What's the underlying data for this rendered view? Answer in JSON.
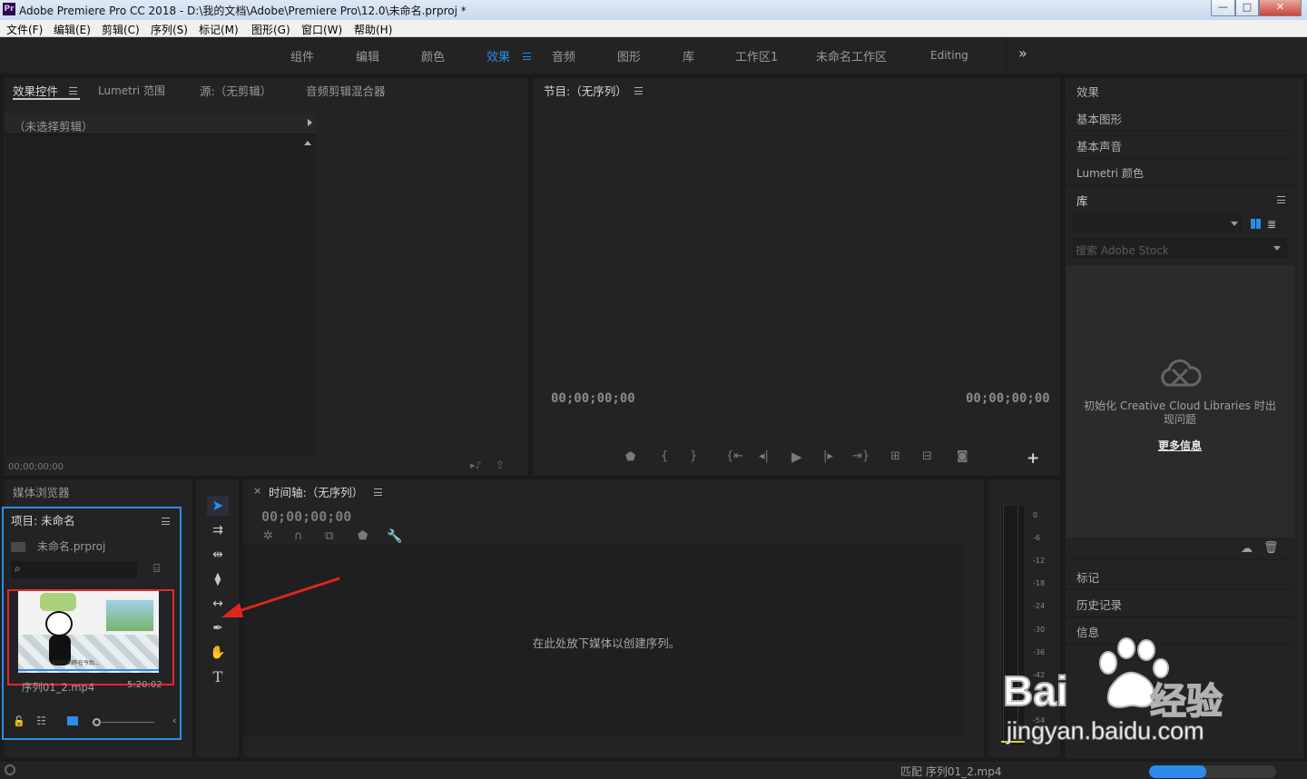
{
  "window": {
    "app_icon": "Pr",
    "title": "Adobe Premiere Pro CC 2018 - D:\\我的文档\\Adobe\\Premiere Pro\\12.0\\未命名.prproj *",
    "controls": {
      "minimize": "—",
      "maximize": "□",
      "close": "✕"
    }
  },
  "menu": [
    "文件(F)",
    "编辑(E)",
    "剪辑(C)",
    "序列(S)",
    "标记(M)",
    "图形(G)",
    "窗口(W)",
    "帮助(H)"
  ],
  "workspaces": {
    "items": [
      "组件",
      "编辑",
      "颜色",
      "效果",
      "音频",
      "图形",
      "库",
      "工作区1",
      "未命名工作区",
      "Editing"
    ],
    "active": "效果",
    "overflow": "»"
  },
  "source_panel": {
    "tabs": [
      "效果控件",
      "Lumetri 范围",
      "源:（无剪辑）",
      "音频剪辑混合器"
    ],
    "active_tab": "效果控件",
    "clip_label": "（未选择剪辑）",
    "timecode": "00;00;00;00"
  },
  "program_panel": {
    "title": "节目:（无序列）",
    "timecode_left": "00;00;00;00",
    "timecode_right": "00;00;00;00",
    "add_button": "+"
  },
  "right_panel": {
    "items": [
      "效果",
      "基本图形",
      "基本声音",
      "Lumetri 颜色"
    ],
    "library_title": "库",
    "stock_placeholder": "搜索 Adobe Stock",
    "cloud_message_1": "初始化 Creative Cloud Libraries 时出",
    "cloud_message_2": "现问题",
    "more_info": "更多信息",
    "bottom_items": [
      "标记",
      "历史记录",
      "信息"
    ]
  },
  "project_panel": {
    "tab_media_browser": "媒体浏览器",
    "title": "项目: 未命名",
    "project_file": "未命名.prproj",
    "search_value": "",
    "clip_name": "序列01_2.mp4",
    "clip_duration": "5:20:02",
    "thumb_caption": "当我听到昨在今后..."
  },
  "timeline": {
    "title": "时间轴:（无序列）",
    "close_label": "×",
    "timecode": "00;00;00;00",
    "drop_message": "在此处放下媒体以创建序列。"
  },
  "audio_meter": {
    "labels": [
      "0",
      "-6",
      "-12",
      "-18",
      "-24",
      "-30",
      "-36",
      "-42",
      "-48",
      "-54",
      "dB"
    ]
  },
  "status_bar": {
    "message": "匹配 序列01_2.mp4",
    "progress": 0.45
  },
  "watermark": {
    "text_1": "Bai",
    "text_2": "经验",
    "url": "jingyan.baidu.com"
  },
  "colors": {
    "accent_blue": "#2d8ceb",
    "highlight_red": "#e8262b",
    "arrow_red": "#e0261f",
    "panel_bg": "#232323"
  }
}
